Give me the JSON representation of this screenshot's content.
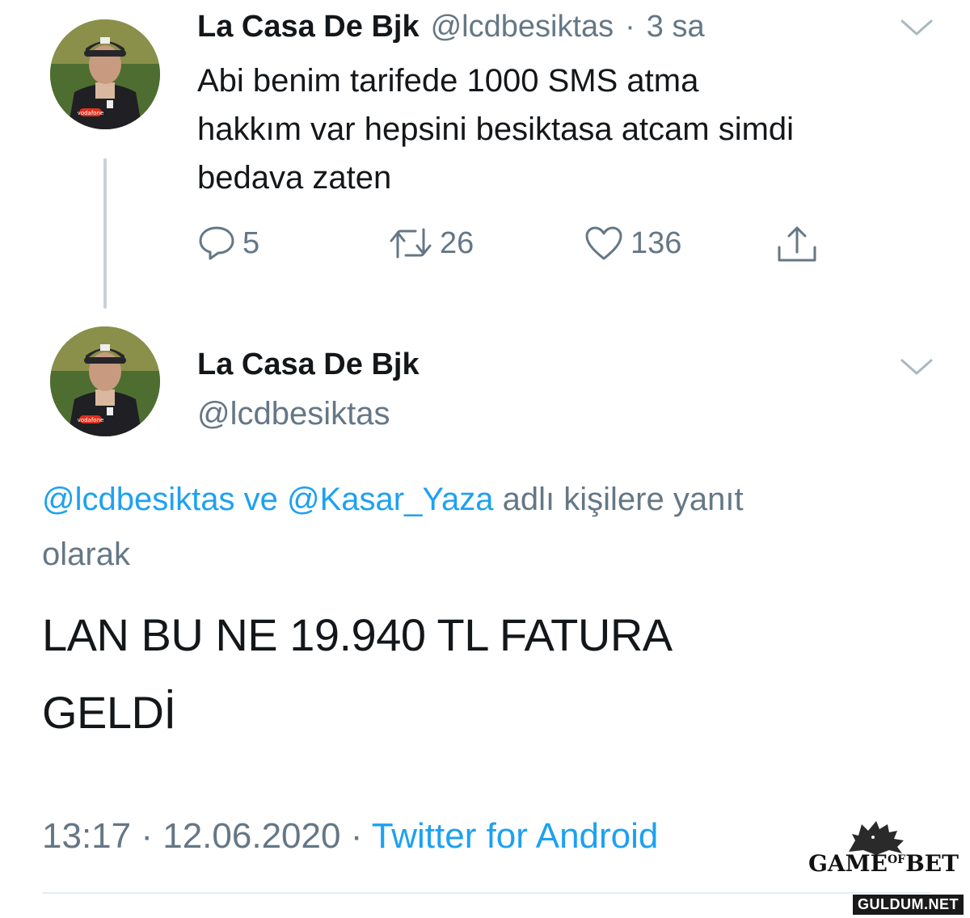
{
  "tweet1": {
    "author_name": "La Casa De Bjk",
    "author_handle": "@lcdbesiktas",
    "separator": "·",
    "time_ago": "3 sa",
    "text_lines": [
      "Abi benim tarifede 1000 SMS atma",
      "hakkım var hepsini besiktasa atcam simdi",
      "bedava zaten"
    ],
    "reply_count": "5",
    "retweet_count": "26",
    "like_count": "136",
    "avatar_logo_text": "vodafone"
  },
  "tweet2": {
    "author_name": "La Casa De Bjk",
    "author_handle": "@lcdbesiktas",
    "avatar_logo_text": "vodafone",
    "reply_to": {
      "mention1": "@lcdbesiktas",
      "connector": "ve",
      "mention2": "@Kasar_Yaza",
      "suffix_line1": "adlı kişilere yanıt",
      "suffix_line2": "olarak"
    },
    "text_lines": [
      "LAN BU NE 19.940 TL FATURA",
      "GELDİ"
    ],
    "time": "13:17",
    "separator": "·",
    "date": "12.06.2020",
    "source": "Twitter for Android"
  },
  "branding": {
    "logo_part1": "GAME",
    "logo_part2": "OF",
    "logo_part3": "BET",
    "watermark": "GULDUM.NET"
  },
  "colors": {
    "link": "#1da1f2",
    "muted": "#657786",
    "text": "#14171a"
  },
  "icons": [
    "reply-icon",
    "retweet-icon",
    "like-icon",
    "share-icon",
    "chevron-down-icon",
    "wolf-icon"
  ]
}
